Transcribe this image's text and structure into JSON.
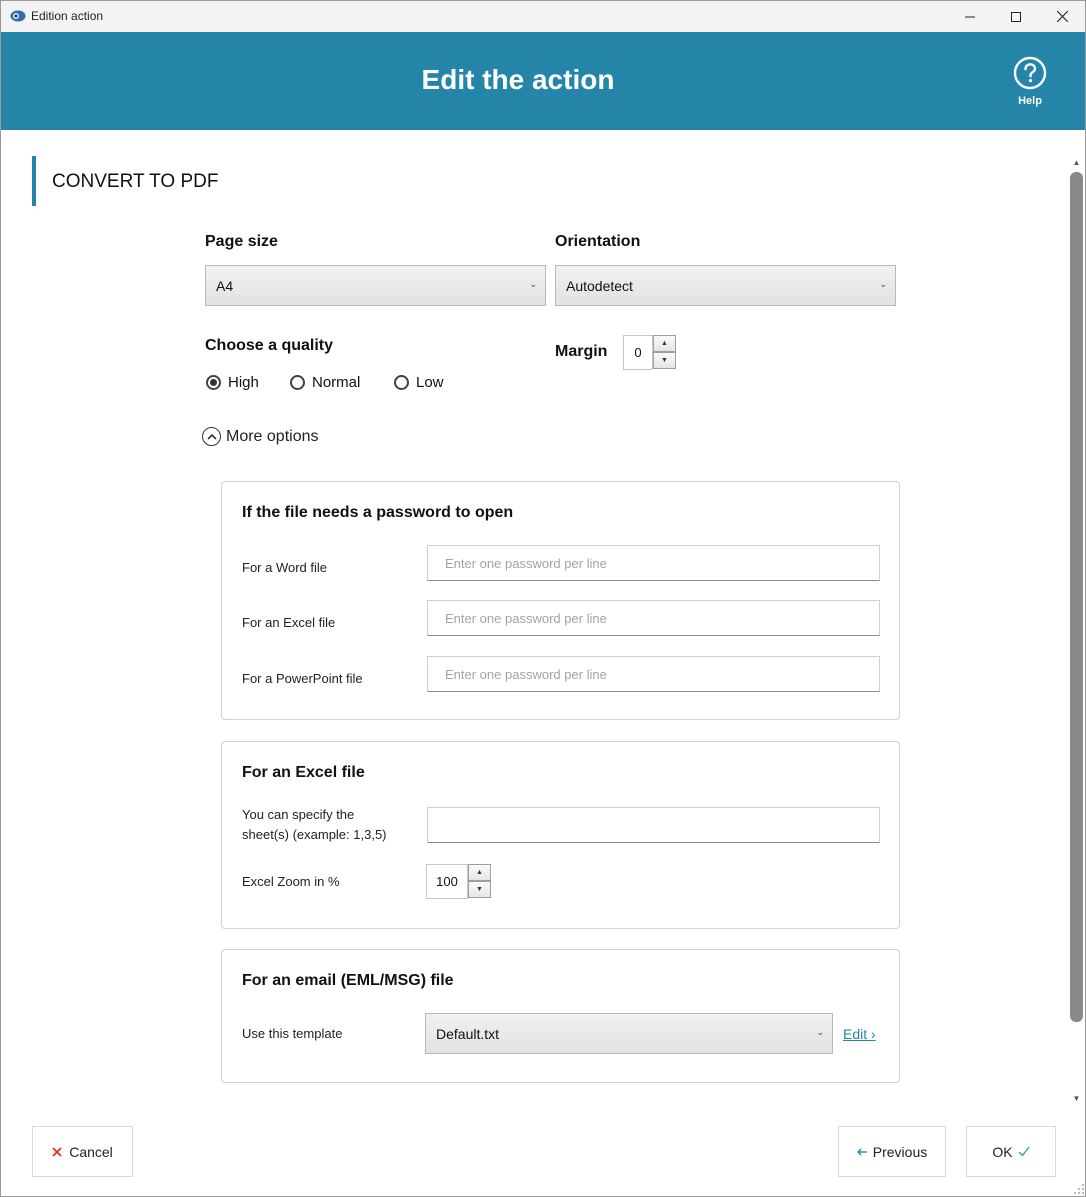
{
  "window": {
    "title": "Edition action"
  },
  "header": {
    "title": "Edit the action",
    "help_label": "Help"
  },
  "section": {
    "title": "CONVERT TO PDF"
  },
  "page_size": {
    "label": "Page size",
    "value": "A4"
  },
  "orientation": {
    "label": "Orientation",
    "value": "Autodetect"
  },
  "quality": {
    "label": "Choose a quality",
    "options": [
      {
        "label": "High",
        "checked": true
      },
      {
        "label": "Normal",
        "checked": false
      },
      {
        "label": "Low",
        "checked": false
      }
    ]
  },
  "margin": {
    "label": "Margin",
    "value": "0"
  },
  "more_options": {
    "label": "More options"
  },
  "password_panel": {
    "title": "If the file needs a password to open",
    "fields": [
      {
        "label": "For a Word file",
        "placeholder": "Enter one password per line"
      },
      {
        "label": "For an Excel file",
        "placeholder": "Enter one password per line"
      },
      {
        "label": "For a PowerPoint file",
        "placeholder": "Enter one password per line"
      }
    ]
  },
  "excel_panel": {
    "title": "For an Excel file",
    "sheets_label_line1": "You can specify the",
    "sheets_label_line2": "sheet(s) (example: 1,3,5)",
    "sheets_value": "",
    "zoom_label": "Excel Zoom in %",
    "zoom_value": "100"
  },
  "email_panel": {
    "title": "For an email (EML/MSG) file",
    "template_label": "Use this template",
    "template_value": "Default.txt",
    "edit_label": "Edit ›"
  },
  "footer": {
    "cancel_label": "Cancel",
    "previous_label": "Previous",
    "ok_label": "OK"
  },
  "colors": {
    "accent": "#2485a8",
    "cancel_icon": "#d9322b",
    "ok_check": "#3aa66a"
  }
}
